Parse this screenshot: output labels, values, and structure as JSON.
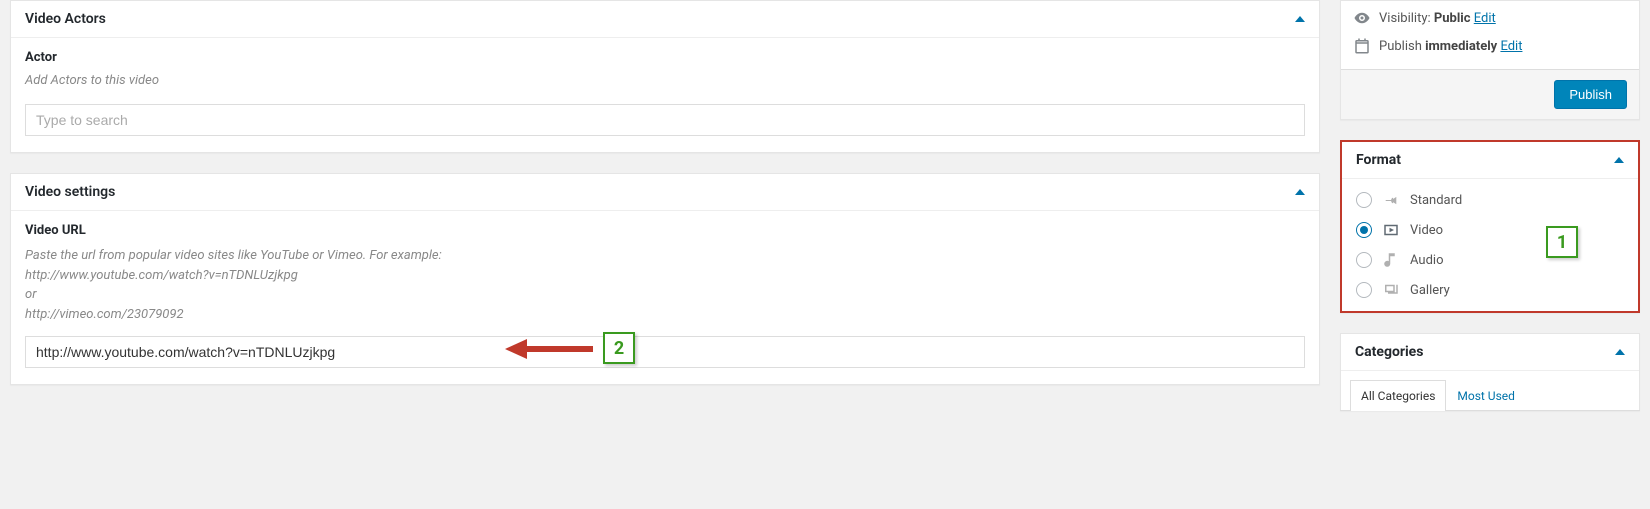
{
  "panels": {
    "video_actors": {
      "title": "Video Actors"
    },
    "video_settings": {
      "title": "Video settings"
    },
    "format": {
      "title": "Format"
    },
    "categories": {
      "title": "Categories"
    }
  },
  "actors": {
    "label": "Actor",
    "desc": "Add Actors to this video",
    "search_placeholder": "Type to search"
  },
  "video": {
    "url_label": "Video URL",
    "help_line1": "Paste the url from popular video sites like YouTube or Vimeo. For example:",
    "help_line2": "http://www.youtube.com/watch?v=nTDNLUzjkpg",
    "help_line3": "or",
    "help_line4": "http://vimeo.com/23079092",
    "url_value": "http://www.youtube.com/watch?v=nTDNLUzjkpg"
  },
  "publish": {
    "visibility_label": "Visibility:",
    "visibility_value": "Public",
    "edit_link": "Edit",
    "publish_label": "Publish",
    "publish_value": "immediately",
    "button": "Publish"
  },
  "formats": {
    "standard": "Standard",
    "video": "Video",
    "audio": "Audio",
    "gallery": "Gallery",
    "selected": "video"
  },
  "categories": {
    "tab_all": "All Categories",
    "tab_most": "Most Used"
  },
  "annotations": {
    "badge1": "1",
    "badge2": "2"
  }
}
